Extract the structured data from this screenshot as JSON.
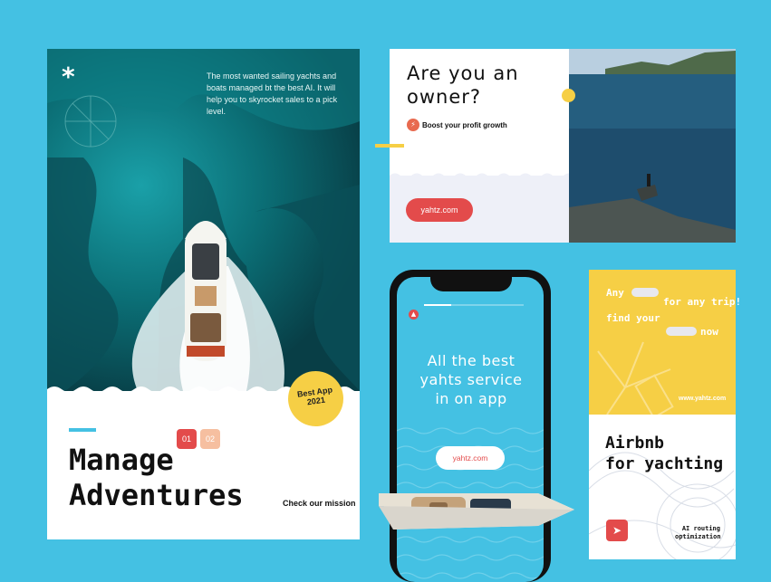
{
  "card_manage": {
    "intro": "The most wanted sailing yachts and boats managed bt the best AI. It will help you to skyrocket sales to a pick level.",
    "logo_glyph": "*",
    "title_line1": "Manage",
    "title_line2": "Adventures",
    "pager": [
      "01",
      "02"
    ],
    "mission_link": "Check our mission",
    "badge_line1": "Best App",
    "badge_line2": "2021"
  },
  "card_owner": {
    "title_line1": "Are you an",
    "title_line2": "owner?",
    "subtitle": "Boost your profit growth",
    "button_label": "yahtz.com"
  },
  "phone": {
    "headline_line1": "All the best",
    "headline_line2": "yahts service",
    "headline_line3": "in on app",
    "button_label": "yahtz.com"
  },
  "card_airbnb": {
    "line1": "Any",
    "line2": "for any trip!",
    "line3": "find your",
    "line4": "now",
    "url": "www.yahtz.com",
    "title_line1": "Airbnb",
    "title_line2": "for yachting",
    "footer_line1": "AI routing",
    "footer_line2": "optimization"
  },
  "colors": {
    "background": "#44c1e3",
    "accent_red": "#e34b4b",
    "accent_yellow": "#f6cf45",
    "peach": "#f6bfa0"
  },
  "icons": [
    "asterisk-logo-icon",
    "bolt-icon",
    "boat-icon",
    "navigation-arrow-icon"
  ]
}
